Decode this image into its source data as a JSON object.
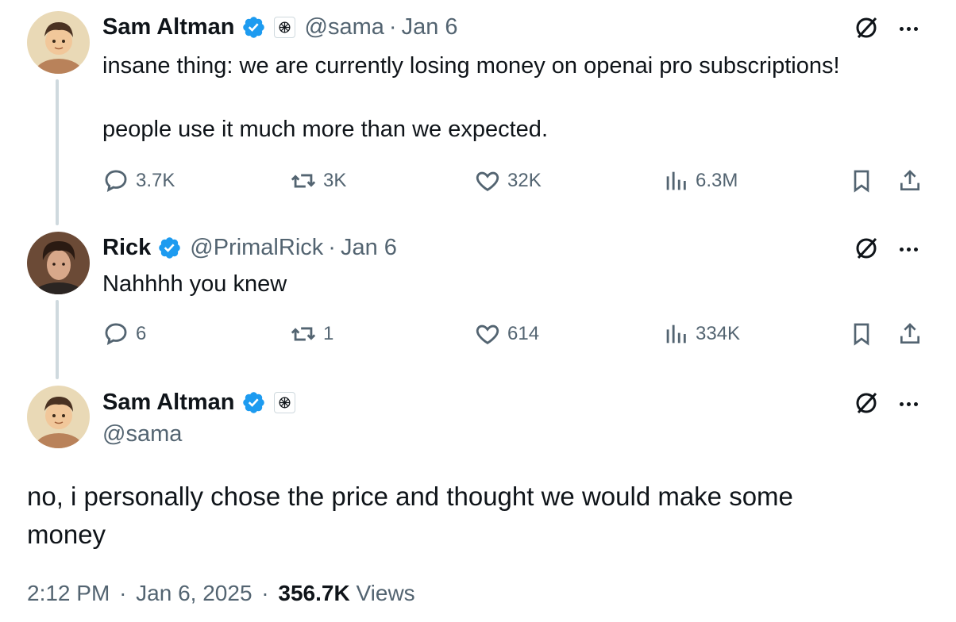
{
  "thread": [
    {
      "display_name": "Sam Altman",
      "verified": true,
      "handle": "@sama",
      "date": "Jan 6",
      "text_lines": [
        "insane thing: we are currently losing money on openai pro subscriptions!",
        "",
        "people use it much more than we expected."
      ],
      "stats": {
        "replies": "3.7K",
        "reposts": "3K",
        "likes": "32K",
        "views": "6.3M"
      }
    },
    {
      "display_name": "Rick",
      "verified": true,
      "handle": "@PrimalRick",
      "date": "Jan 6",
      "text_lines": [
        "Nahhhh you knew"
      ],
      "stats": {
        "replies": "6",
        "reposts": "1",
        "likes": "614",
        "views": "334K"
      }
    }
  ],
  "main_tweet": {
    "display_name": "Sam Altman",
    "verified": true,
    "handle": "@sama",
    "text": "no, i personally chose the price and thought we would make some money",
    "time": "2:12 PM",
    "date": "Jan 6, 2025",
    "views_count": "356.7K",
    "views_label": "Views"
  },
  "separators": {
    "dot": "·"
  },
  "colors": {
    "verified": "#1d9bf0",
    "muted": "#536471",
    "text": "#0f1419",
    "thread_line": "#cfd9de"
  },
  "icons": [
    "reply-icon",
    "repost-icon",
    "like-icon",
    "views-icon",
    "bookmark-icon",
    "share-icon",
    "grok-icon",
    "more-icon",
    "verified-badge-icon",
    "openai-affiliate-icon"
  ]
}
